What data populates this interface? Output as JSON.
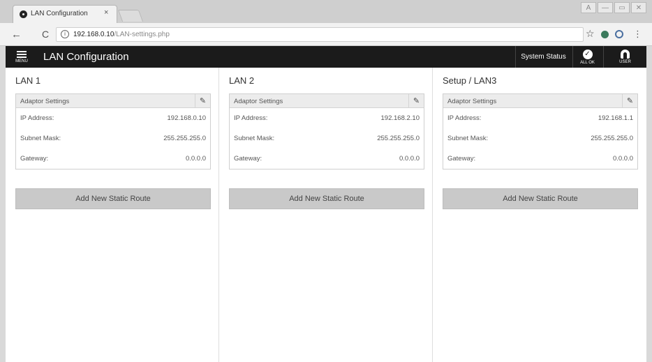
{
  "browser": {
    "tab_title": "LAN Configuration",
    "tab_close": "×",
    "url_host": "192.168.0.10",
    "url_path": "/LAN-settings.php",
    "back_glyph": "←",
    "reload_glyph": "C",
    "star_glyph": "☆",
    "kebab_glyph": "⋮",
    "window_controls": [
      "A",
      "—",
      "▭",
      "✕"
    ]
  },
  "header": {
    "menu_label": "MENU",
    "title": "LAN Configuration",
    "system_status": "System Status",
    "allok_label": "ALL OK",
    "user_label": "USER"
  },
  "columns": [
    {
      "title": "LAN 1",
      "card_title": "Adaptor Settings",
      "rows": [
        {
          "label": "IP Address:",
          "value": "192.168.0.10"
        },
        {
          "label": "Subnet Mask:",
          "value": "255.255.255.0"
        },
        {
          "label": "Gateway:",
          "value": "0.0.0.0"
        }
      ],
      "route_button": "Add New Static Route"
    },
    {
      "title": "LAN 2",
      "card_title": "Adaptor Settings",
      "rows": [
        {
          "label": "IP Address:",
          "value": "192.168.2.10"
        },
        {
          "label": "Subnet Mask:",
          "value": "255.255.255.0"
        },
        {
          "label": "Gateway:",
          "value": "0.0.0.0"
        }
      ],
      "route_button": "Add New Static Route"
    },
    {
      "title": "Setup / LAN3",
      "card_title": "Adaptor Settings",
      "rows": [
        {
          "label": "IP Address:",
          "value": "192.168.1.1"
        },
        {
          "label": "Subnet Mask:",
          "value": "255.255.255.0"
        },
        {
          "label": "Gateway:",
          "value": "0.0.0.0"
        }
      ],
      "route_button": "Add New Static Route"
    }
  ]
}
